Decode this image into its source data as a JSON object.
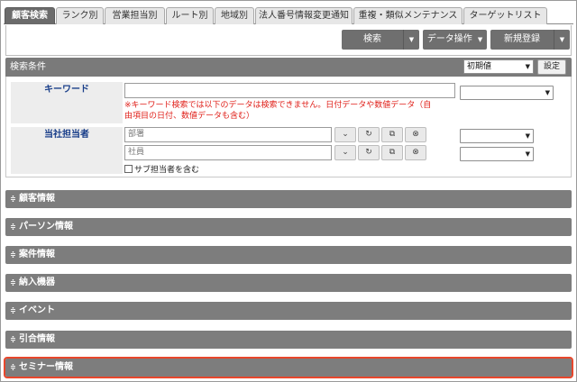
{
  "tabs": [
    {
      "label": "顧客検索",
      "active": true
    },
    {
      "label": "ランク別"
    },
    {
      "label": "営業担当別"
    },
    {
      "label": "ルート別"
    },
    {
      "label": "地域別"
    },
    {
      "label": "法人番号情報変更通知"
    },
    {
      "label": "重複・類似メンテナンス"
    },
    {
      "label": "ターゲットリスト"
    }
  ],
  "toolbar": {
    "search": "検索",
    "data_ops": "データ操作",
    "new_reg": "新規登録"
  },
  "search_panel": {
    "title": "検索条件",
    "preset_value": "初期値",
    "settings_label": "設定",
    "keyword_label": "キーワード",
    "keyword_value": "",
    "keyword_warning_line1": "※キーワード検索では以下のデータは検索できません。日付データや数値データ（自",
    "keyword_warning_line2": "由項目の日付、数値データも含む）",
    "owner_label": "当社担当者",
    "dept_placeholder": "部署",
    "staff_placeholder": "社員",
    "sub_owner_checkbox": "サブ担当者を含む"
  },
  "sections": [
    {
      "label": "顧客情報"
    },
    {
      "label": "パーソン情報"
    },
    {
      "label": "案件情報"
    },
    {
      "label": "納入機器"
    },
    {
      "label": "イベント"
    },
    {
      "label": "引合情報"
    },
    {
      "label": "セミナー情報",
      "highlighted": true
    }
  ],
  "colors": {
    "header_bg": "#7a7a7a",
    "label_text": "#1a3f8a",
    "warning_text": "#e0201a",
    "highlight_border": "#e8472c"
  }
}
